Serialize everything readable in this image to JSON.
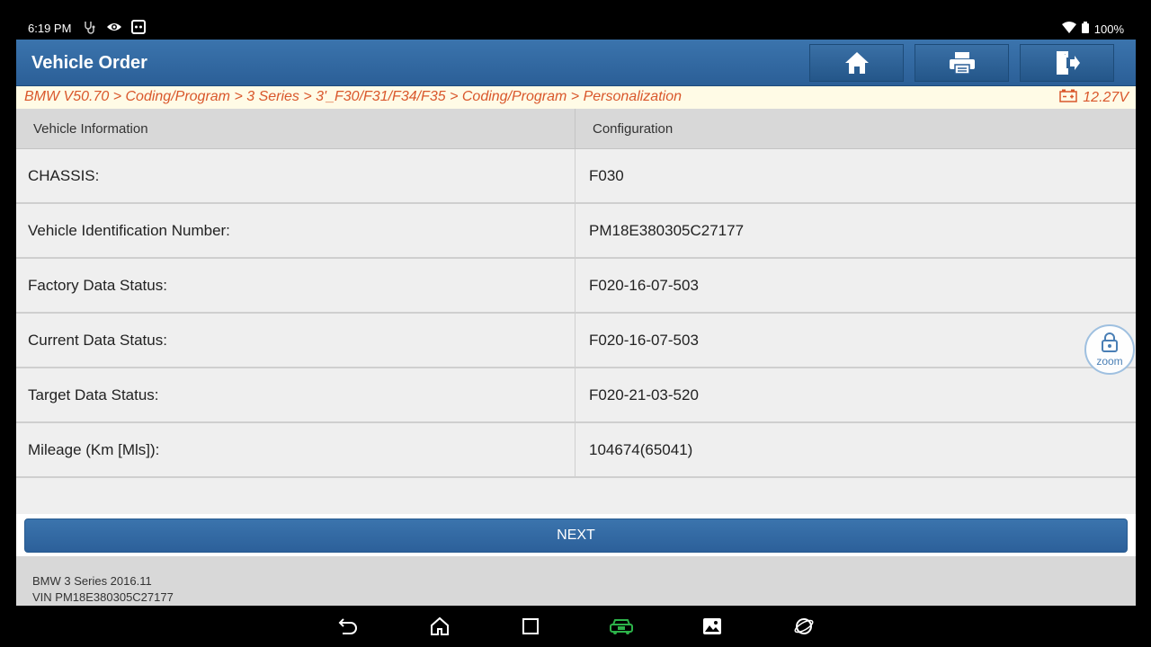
{
  "status_bar": {
    "time": "6:19 PM",
    "battery": "100%",
    "icons_left": [
      "stethoscope-icon",
      "eye-icon",
      "cast-icon"
    ],
    "icons_right": [
      "wifi-icon",
      "battery-icon"
    ]
  },
  "header": {
    "title": "Vehicle Order",
    "buttons": [
      "home-icon",
      "print-icon",
      "exit-icon"
    ]
  },
  "breadcrumb": {
    "path": "BMW V50.70 > Coding/Program > 3 Series > 3'_F30/F31/F34/F35 > Coding/Program > Personalization",
    "voltage": "12.27V"
  },
  "table": {
    "headers": [
      "Vehicle Information",
      "Configuration"
    ],
    "rows": [
      {
        "label": "CHASSIS:",
        "value": "F030"
      },
      {
        "label": "Vehicle Identification Number:",
        "value": "PM18E380305C27177"
      },
      {
        "label": "Factory Data Status:",
        "value": "F020-16-07-503"
      },
      {
        "label": "Current Data Status:",
        "value": "F020-16-07-503"
      },
      {
        "label": "Target Data Status:",
        "value": "F020-21-03-520"
      },
      {
        "label": "Mileage (Km [Mls]):",
        "value": "104674(65041)"
      }
    ]
  },
  "actions": {
    "next_label": "NEXT"
  },
  "zoom": {
    "label": "zoom"
  },
  "footer": {
    "vehicle": "BMW 3 Series 2016.11",
    "vin": "VIN PM18E380305C27177"
  },
  "nav": [
    "back-icon",
    "home-icon",
    "recents-icon",
    "vci-icon",
    "screenshot-icon",
    "browser-icon"
  ],
  "colors": {
    "header_blue": "#2f659d",
    "breadcrumb_orange": "#d9572b",
    "vci_green": "#2db34a"
  }
}
